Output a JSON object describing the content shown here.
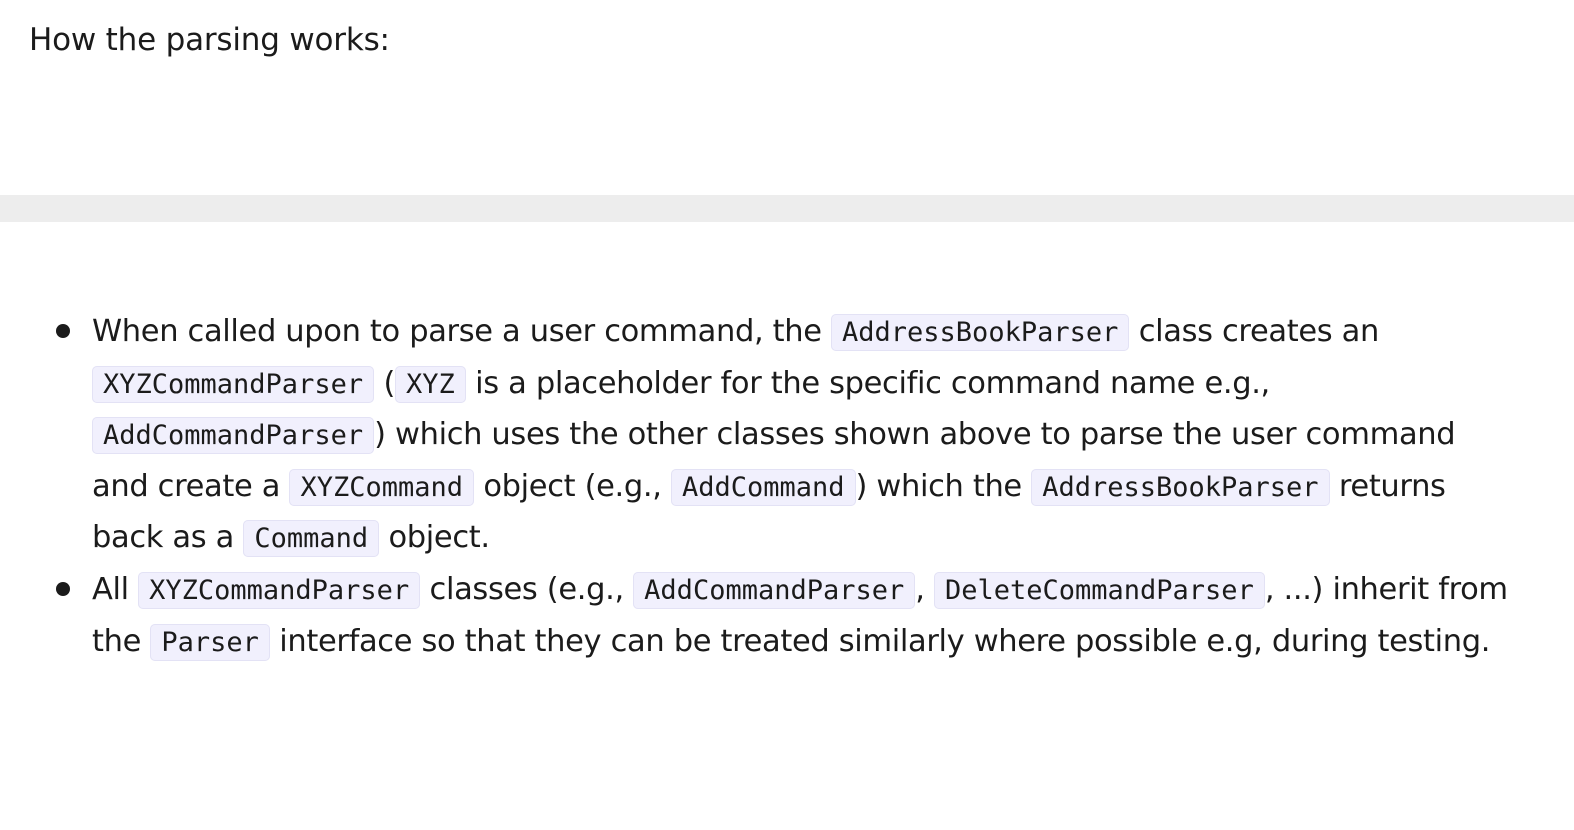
{
  "intro": "How the parsing works:",
  "bullets": [
    {
      "parts": [
        "When called upon to parse a user command, the ",
        "AddressBookParser",
        " class creates an ",
        "XYZCommandParser",
        " (",
        "XYZ",
        " is a placeholder for the specific command name e.g., ",
        "AddCommandParser",
        ") which uses the other classes shown above to parse the user command and create a ",
        "XYZCommand",
        " object (e.g., ",
        "AddCommand",
        ") which the ",
        "AddressBookParser",
        " returns back as a ",
        "Command",
        " object."
      ]
    },
    {
      "parts": [
        "All ",
        "XYZCommandParser",
        " classes (e.g., ",
        "AddCommandParser",
        ", ",
        "DeleteCommandParser",
        ", ...) inherit from the ",
        "Parser",
        " interface so that they can be treated similarly where possible e.g, during testing."
      ]
    }
  ]
}
